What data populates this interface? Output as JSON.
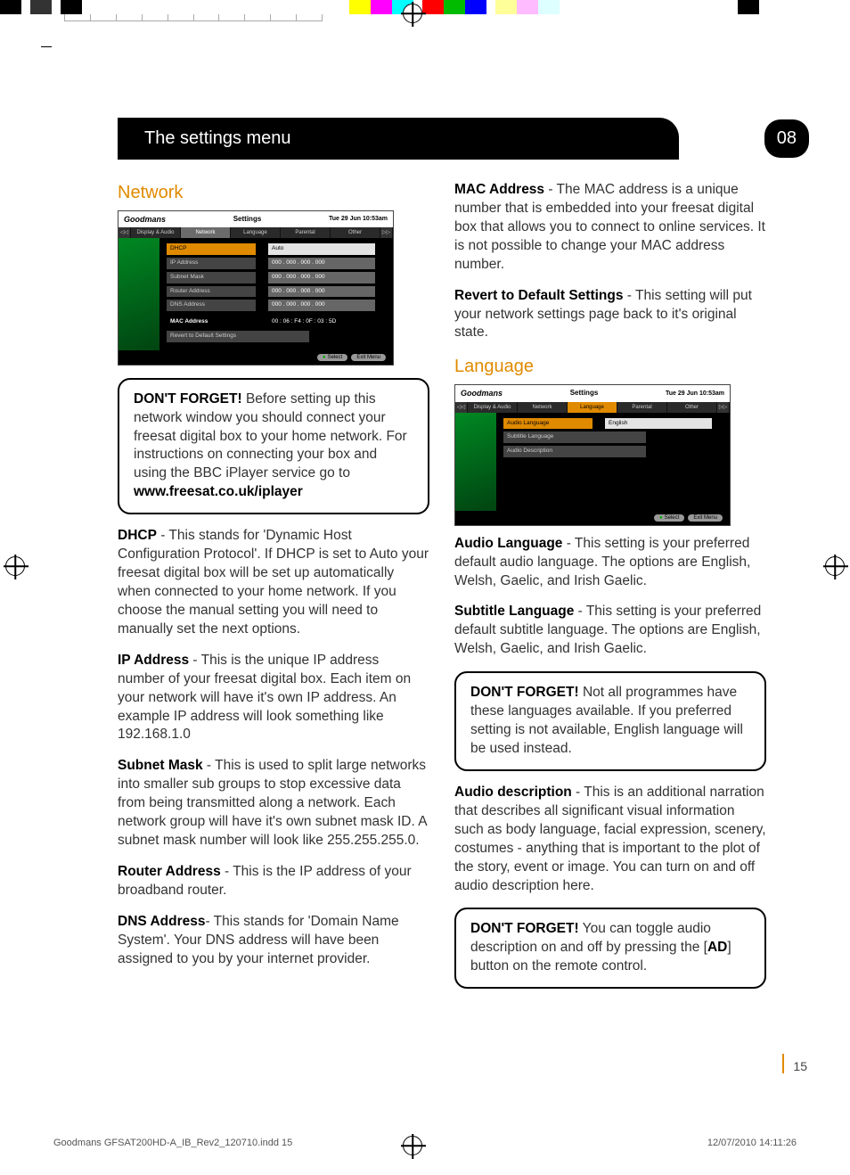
{
  "header": {
    "title": "The settings menu",
    "page_badge": "08"
  },
  "network": {
    "heading": "Network",
    "shot": {
      "brand": "Goodmans",
      "title": "Settings",
      "datetime": "Tue 29 Jun 10:53am",
      "tabs": [
        "Display & Audio",
        "Network",
        "Language",
        "Parental",
        "Other"
      ],
      "active_tab": "Network",
      "rows": [
        {
          "label": "DHCP",
          "value": "Auto",
          "sel": true
        },
        {
          "label": "IP Address",
          "value": "000 . 000 . 000 . 000"
        },
        {
          "label": "Subnet Mask",
          "value": "000 . 000 . 000 . 000"
        },
        {
          "label": "Router Address",
          "value": "000 . 000 . 000 . 000"
        },
        {
          "label": "DNS Address",
          "value": "000 . 000 . 000 . 000"
        },
        {
          "label": "MAC Address",
          "value": "00 : 06 : F4 : 0F : 03 : 5D",
          "plain": true
        },
        {
          "label": "Revert to Default Settings",
          "value": ""
        }
      ],
      "foot": [
        "Select",
        "Exit Menu"
      ]
    },
    "callout1_lead": "DON'T FORGET!",
    "callout1_body": " Before setting up this network window you should connect your freesat digital box to your home network. For instructions on connecting your box and using the BBC iPlayer service go to ",
    "callout1_link": "www.freesat.co.uk/iplayer",
    "dhcp_t": "DHCP",
    "dhcp": " - This stands for 'Dynamic Host Configuration Protocol'. If DHCP is set to Auto your freesat digital box will be set up automatically when connected to your home network. If you choose the manual setting you will need to manually set the next options.",
    "ip_t": "IP Address",
    "ip": " - This is the unique IP address number of your freesat digital box. Each item on your network will have it's own IP address. An example IP address will look something like 192.168.1.0",
    "sn_t": "Subnet Mask",
    "sn": " - This is used to split large networks into smaller sub groups to stop excessive data from being transmitted along a network. Each network group will have it's own subnet mask ID. A subnet mask number will look like 255.255.255.0.",
    "rt_t": "Router Address",
    "rt": " - This is the IP address of your broadband router.",
    "dns_t": "DNS Address",
    "dns": "- This stands for 'Domain Name System'. Your DNS address will have been assigned to you by your internet provider.",
    "mac_t": "MAC Address",
    "mac": " - The MAC address is a unique number that is embedded into your freesat digital box that allows you to connect to online services. It is not possible to change your MAC address number.",
    "rev_t": "Revert to Default Settings",
    "rev": " - This setting will put your network settings page back to it's original state."
  },
  "language": {
    "heading": "Language",
    "shot": {
      "brand": "Goodmans",
      "title": "Settings",
      "datetime": "Tue 29 Jun 10:53am",
      "tabs": [
        "Display & Audio",
        "Network",
        "Language",
        "Parental",
        "Other"
      ],
      "active_tab": "Language",
      "rows": [
        {
          "label": "Audio Language",
          "value": "English",
          "sel": true
        },
        {
          "label": "Subtitle Language",
          "value": ""
        },
        {
          "label": "Audio Description",
          "value": ""
        }
      ],
      "foot": [
        "Select",
        "Exit Menu"
      ]
    },
    "al_t": "Audio Language",
    "al": " - This setting is your preferred default audio language. The options are English, Welsh, Gaelic, and Irish Gaelic.",
    "sl_t": "Subtitle Language",
    "sl": " - This setting is your preferred default subtitle language. The options are English, Welsh, Gaelic, and Irish Gaelic.",
    "c2_lead": "DON'T FORGET!",
    "c2": " Not all programmes have these languages available. If you preferred setting is not available, English language will be used instead.",
    "ad_t": "Audio description",
    "ad": " - This is an additional narration that describes all significant visual information such as body language, facial expression, scenery, costumes - anything that is important to the plot of the story, event or image. You can turn on and off audio description here.",
    "c3_lead": "DON'T FORGET!",
    "c3a": " You can toggle audio description on and off by pressing the [",
    "c3b": "AD",
    "c3c": "] button on the remote control."
  },
  "footer": {
    "pagenum": "15",
    "slug": "Goodmans GFSAT200HD-A_IB_Rev2_120710.indd   15",
    "slugdate": "12/07/2010   14:11:26"
  },
  "colorbar": [
    "#000",
    "#fff",
    "#000",
    "#fff",
    "#000",
    "#fff",
    "#eee",
    "#fff",
    "#fff",
    "#fff",
    "#fff",
    "#fff",
    "#fff",
    "#fff",
    "#fff",
    "#fff",
    "#fff",
    "#fff",
    "#fff",
    "#fff",
    "#fff",
    "#fff",
    "#fff",
    "#fff",
    "#fff",
    "#fff",
    "#ff0",
    "#f0f",
    "#0ff",
    "#fff",
    "#f00",
    "#0c0",
    "#00f",
    "#fff",
    "#ff8",
    "#f8f",
    "#fff",
    "#fff",
    "#fff",
    "#fff",
    "#000"
  ]
}
